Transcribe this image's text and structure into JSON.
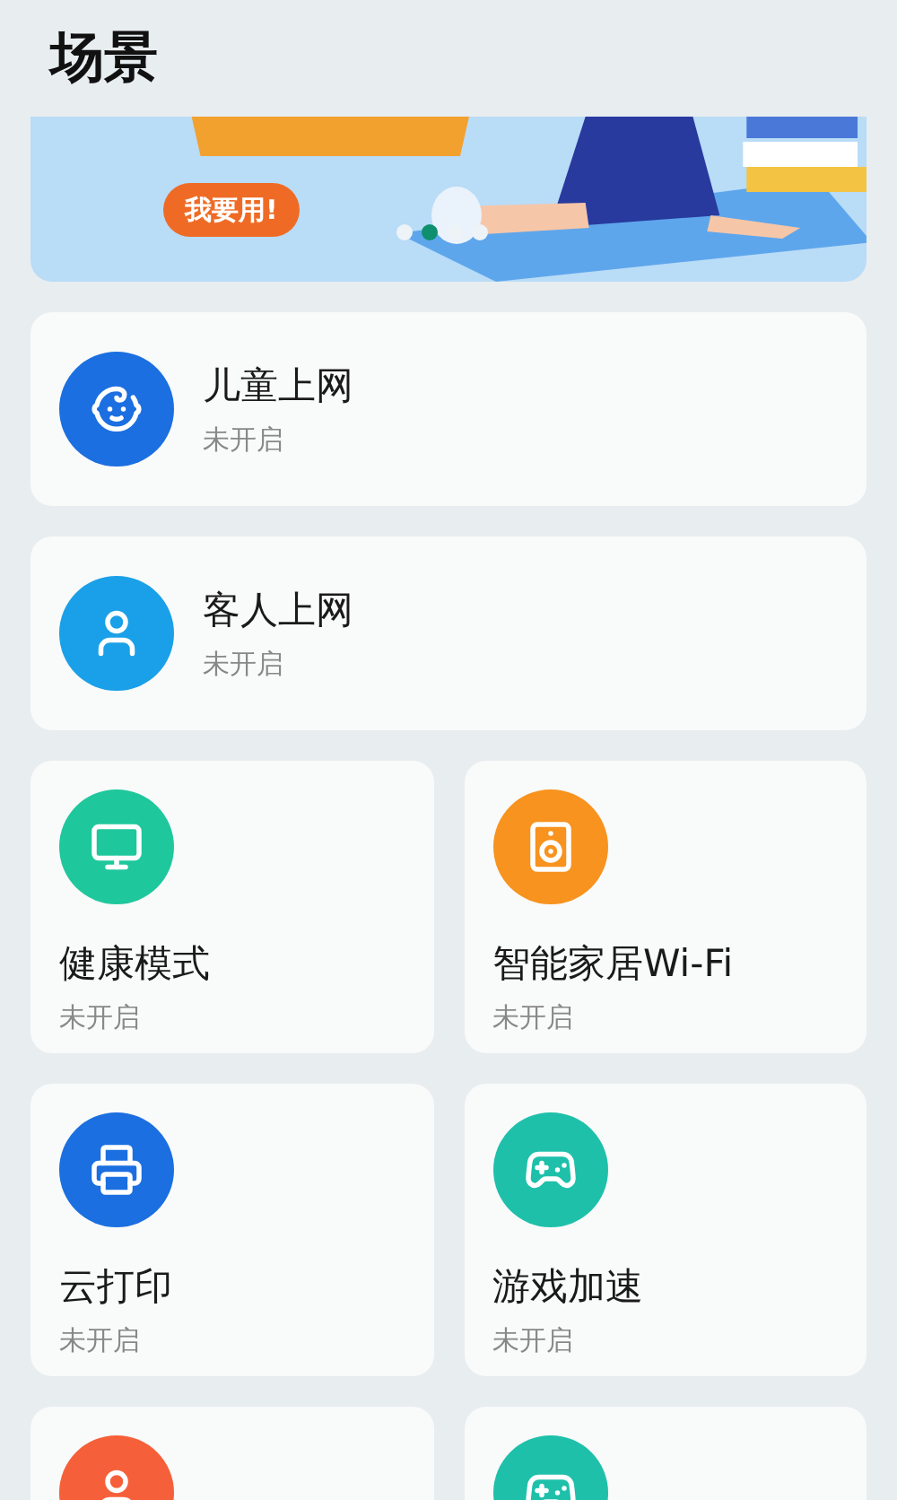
{
  "header": {
    "title": "场景"
  },
  "banner": {
    "kind": "picture",
    "button": "我要用!",
    "dots": [
      {
        "selected": false
      },
      {
        "selected": true
      },
      {
        "selected": false
      },
      {
        "selected": false
      }
    ]
  },
  "wide_cards": [
    {
      "kind": "baby",
      "color": "#1b6fe0",
      "title": "儿童上网",
      "status": "未开启"
    },
    {
      "kind": "user",
      "color": "#1aa0e8",
      "title": "客人上网",
      "status": "未开启"
    }
  ],
  "grid_cards": [
    {
      "kind": "monitor",
      "color": "#1fc79c",
      "title": "健康模式",
      "status": "未开启"
    },
    {
      "kind": "speaker",
      "color": "#f7931e",
      "title": "智能家居Wi-Fi",
      "status": "未开启"
    },
    {
      "kind": "printer",
      "color": "#1b6fe0",
      "title": "云打印",
      "status": "未开启"
    },
    {
      "kind": "gamepad",
      "color": "#1ec0aa",
      "title": "游戏加速",
      "status": "未开启"
    }
  ],
  "partial_cards": [
    {
      "kind": "user",
      "color": "#f5603a"
    },
    {
      "kind": "gamepad",
      "color": "#1ec0aa"
    }
  ]
}
